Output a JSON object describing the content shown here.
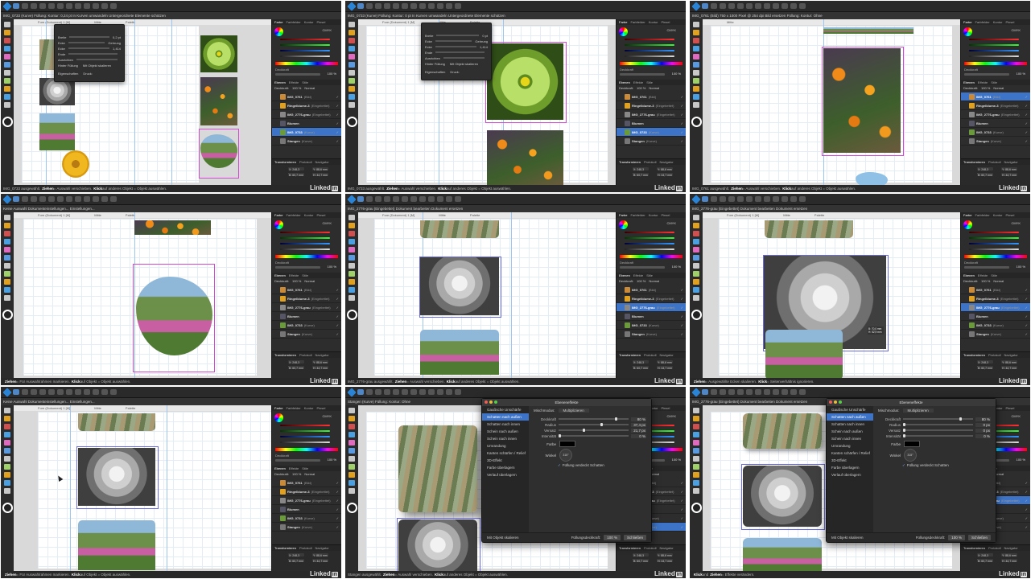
{
  "brand": {
    "watermark": "Linked",
    "watermark_badge": "in"
  },
  "colors": {
    "accent": "#3d74c7",
    "selection": "#d14bd1",
    "background": "#1e1e1e"
  },
  "panels": [
    {
      "id": 1,
      "ctx_text": "IMG_0733 (Kurve)   Füllung:   Kontur:   0,24 pt   In Kurven umwandeln   Untergeordnete Elemente schützen",
      "doc_tabs": [
        "Fore (Dokument) 1 [M]",
        "Mitte",
        "Palette"
      ],
      "right_tabs": [
        "Farbe",
        "Farbfelder",
        "Kontur",
        "Pinsel"
      ],
      "layers": [
        {
          "name": "IMG_0761",
          "sub": "(Bild)",
          "selected": false
        },
        {
          "name": "Ringelblume-3",
          "sub": "(Eingebettet)",
          "selected": false
        },
        {
          "name": "IMG_2776-grau",
          "sub": "(Eingebettet)",
          "selected": false
        },
        {
          "name": "Blumen",
          "sub": "",
          "selected": false
        },
        {
          "name": "IMG_0733",
          "sub": "(Kurve)",
          "selected": true
        },
        {
          "name": "Stangen",
          "sub": "(Kurve)",
          "selected": false
        }
      ],
      "status": {
        "prefix": "IMG_0733 ausgewählt.",
        "b1": "Ziehen",
        "t1": " = Auswahl verschieben.",
        "b2": "Klick",
        "t2": " auf anderes Objekt = Objekt auswählen."
      },
      "popup": {
        "rows": [
          "Breite",
          "Ecke",
          "Ecke",
          "Ende",
          "Ausrichten"
        ],
        "values": [
          "0,2 pt",
          "Gehrung",
          "1,414",
          "",
          ""
        ],
        "btn1": "Hinter Füllung",
        "btn2": "Mit Objekt skalieren",
        "label": "Eigenschaften",
        "druck": "Druck:"
      }
    },
    {
      "id": 2,
      "ctx_text": "IMG_0733 (Kurve)   Füllung:   Kontur:   0 pt   In Kurven umwandeln   Untergeordnete Elemente schützen",
      "doc_tabs": [
        "Fore (Dokument) 1 [M]",
        "Mitte",
        "Palette"
      ],
      "right_tabs": [
        "Farbe",
        "Farbfelder",
        "Kontur",
        "Pinsel"
      ],
      "layers": [
        {
          "name": "IMG_0761",
          "sub": "(Bild)",
          "selected": false
        },
        {
          "name": "Ringelblume-3",
          "sub": "(Eingebettet)",
          "selected": false
        },
        {
          "name": "IMG_2776-grau",
          "sub": "(Eingebettet)",
          "selected": false
        },
        {
          "name": "Blumen",
          "sub": "",
          "selected": false
        },
        {
          "name": "IMG_0733",
          "sub": "(Kurve)",
          "selected": true
        },
        {
          "name": "Stangen",
          "sub": "(Kurve)",
          "selected": false
        }
      ],
      "status": {
        "prefix": "IMG_0733 ausgewählt.",
        "b1": "Ziehen",
        "t1": " = Auswahl verschieben.",
        "b2": "Klick",
        "t2": " auf anderes Objekt = Objekt auswählen."
      },
      "popup": {
        "rows": [
          "Breite",
          "Ecke",
          "Ecke",
          "Ende",
          "Ausrichten"
        ],
        "values": [
          "0 pt",
          "Gehrung",
          "1,414",
          "",
          ""
        ],
        "btn1": "Hinter Füllung",
        "btn2": "Mit Objekt skalieren",
        "label": "Eigenschaften",
        "druck": "Druck:"
      }
    },
    {
      "id": 3,
      "ctx_text": "IMG_0761 (Bild)   750 x 1000 Pixel @ 254 dpi   Bild ersetzen   Füllung:   Kontur:   Ohne",
      "doc_tabs": [
        "Mitte"
      ],
      "right_tabs": [
        "Farbe",
        "Farbfelder",
        "Kontur",
        "Pinsel"
      ],
      "layers": [
        {
          "name": "IMG_0761",
          "sub": "(Bild)",
          "selected": true
        },
        {
          "name": "Ringelblume-3",
          "sub": "(Eingebettet)",
          "selected": false
        },
        {
          "name": "IMG_2776-grau",
          "sub": "(Eingebettet)",
          "selected": false
        },
        {
          "name": "Blumen",
          "sub": "",
          "selected": false
        },
        {
          "name": "IMG_0733",
          "sub": "(Kurve)",
          "selected": false
        },
        {
          "name": "Stangen",
          "sub": "(Kurve)",
          "selected": false
        }
      ],
      "status": {
        "prefix": "IMG_0761 ausgewählt.",
        "b1": "Ziehen",
        "t1": " = Auswahl verschieben.",
        "b2": "Klick",
        "t2": " auf anderes Objekt = Objekt auswählen."
      }
    },
    {
      "id": 4,
      "ctx_text": "Keine Auswahl   Dokumenteinstellungen...   Einstellungen...",
      "doc_tabs": [
        "Fore (Dokument) 1 [M]",
        "Mitte",
        "Palette"
      ],
      "right_tabs": [
        "Farbe",
        "Farbfelder",
        "Kontur",
        "Pinsel"
      ],
      "layers": [
        {
          "name": "IMG_0761",
          "sub": "(Bild)",
          "selected": false
        },
        {
          "name": "Ringelblume-3",
          "sub": "(Eingebettet)",
          "selected": false
        },
        {
          "name": "IMG_2776-grau",
          "sub": "(Eingebettet)",
          "selected": false
        },
        {
          "name": "Blumen",
          "sub": "",
          "selected": false
        },
        {
          "name": "IMG_0733",
          "sub": "(Kurve)",
          "selected": false
        },
        {
          "name": "Stangen",
          "sub": "(Kurve)",
          "selected": false
        }
      ],
      "status": {
        "prefix": "",
        "b1": "Ziehen",
        "t1": " = Für Auswahlrahmen markieren.",
        "b2": "Klick",
        "t2": " auf Objekt = Objekt auswählen."
      }
    },
    {
      "id": 5,
      "ctx_text": "IMG_2776-grau (Eingebettet)   Dokument bearbeiten   Dokument ersetzen",
      "doc_tabs": [
        "Fore (Dokument) 1 [M]",
        "Mitte",
        "Palette"
      ],
      "right_tabs": [
        "Farbe",
        "Farbfelder",
        "Kontur",
        "Pinsel"
      ],
      "layers": [
        {
          "name": "IMG_0761",
          "sub": "(Bild)",
          "selected": false
        },
        {
          "name": "Ringelblume-3",
          "sub": "(Eingebettet)",
          "selected": false
        },
        {
          "name": "IMG_2776-grau",
          "sub": "(Eingebettet)",
          "selected": true
        },
        {
          "name": "Blumen",
          "sub": "",
          "selected": false
        },
        {
          "name": "IMG_0733",
          "sub": "(Kurve)",
          "selected": false
        },
        {
          "name": "Stangen",
          "sub": "(Kurve)",
          "selected": false
        }
      ],
      "status": {
        "prefix": "IMG_2776-grau ausgewählt.",
        "b1": "Ziehen",
        "t1": " = Auswahl verschieben.",
        "b2": "Klick",
        "t2": " auf anderes Objekt = Objekt auswählen."
      }
    },
    {
      "id": 6,
      "ctx_text": "IMG_2776-grau (Eingebettet)   Dokument bearbeiten   Dokument ersetzen",
      "doc_tabs": [
        "Fore (Dokument) 1 [M]",
        "Mitte",
        "Palette"
      ],
      "right_tabs": [
        "Farbe",
        "Farbfelder",
        "Kontur",
        "Pinsel"
      ],
      "layers": [
        {
          "name": "IMG_0761",
          "sub": "(Bild)",
          "selected": false
        },
        {
          "name": "Ringelblume-3",
          "sub": "(Eingebettet)",
          "selected": false
        },
        {
          "name": "IMG_2776-grau",
          "sub": "(Eingebettet)",
          "selected": true
        },
        {
          "name": "Blumen",
          "sub": "",
          "selected": false
        },
        {
          "name": "IMG_0733",
          "sub": "(Kurve)",
          "selected": false
        },
        {
          "name": "Stangen",
          "sub": "(Kurve)",
          "selected": false
        }
      ],
      "size_badge": "B: 70,0 mm H: 52,9 mm",
      "status": {
        "prefix": "",
        "b1": "Ziehen",
        "t1": " = Ausgewählte Ecken skalieren.",
        "b2": "Klick",
        "t2": " = Seitenverhältnis ignorieren."
      }
    },
    {
      "id": 7,
      "ctx_text": "Keine Auswahl   Dokumenteinstellungen...   Einstellungen...",
      "doc_tabs": [
        "Fore (Dokument) 1 [M]",
        "Mitte",
        "Palette"
      ],
      "right_tabs": [
        "Farbe",
        "Farbfelder",
        "Kontur",
        "Pinsel"
      ],
      "layers": [
        {
          "name": "IMG_0761",
          "sub": "(Bild)",
          "selected": false
        },
        {
          "name": "Ringelblume-3",
          "sub": "(Eingebettet)",
          "selected": false
        },
        {
          "name": "IMG_2776-grau",
          "sub": "(Eingebettet)",
          "selected": false
        },
        {
          "name": "Blumen",
          "sub": "",
          "selected": false
        },
        {
          "name": "IMG_0733",
          "sub": "(Kurve)",
          "selected": false
        },
        {
          "name": "Stangen",
          "sub": "(Kurve)",
          "selected": false
        }
      ],
      "status": {
        "prefix": "",
        "b1": "Ziehen",
        "t1": " = Für Auswahlrahmen markieren.",
        "b2": "Klick",
        "t2": " auf Objekt = Objekt auswählen."
      }
    },
    {
      "id": 8,
      "ctx_text": "Stangen (Kurve)   Füllung:   Kontur:   Ohne",
      "doc_tabs": [],
      "right_tabs": [
        "Farbe",
        "Farbfelder",
        "Kontur",
        "Pinsel"
      ],
      "layers": [
        {
          "name": "IMG_0761",
          "sub": "(Bild)",
          "selected": false
        },
        {
          "name": "Ringelblume-3",
          "sub": "(Eingebettet)",
          "selected": false
        },
        {
          "name": "IMG_2776-grau",
          "sub": "(Eingebettet)",
          "selected": false
        },
        {
          "name": "Blumen",
          "sub": "",
          "selected": false
        },
        {
          "name": "IMG_0733",
          "sub": "(Kurve)",
          "selected": false
        },
        {
          "name": "Stangen",
          "sub": "(Kurve)",
          "selected": true
        }
      ],
      "status": {
        "prefix": "Stangen ausgewählt.",
        "b1": "Ziehen",
        "t1": " = Auswahl verschieben.",
        "b2": "Klick",
        "t2": " auf anderes Objekt = Objekt auswählen."
      },
      "dialog": {
        "title": "Ebeneneffekte",
        "effects": [
          "Gaußsche Unschärfe",
          "Schatten nach außen",
          "Schatten nach innen",
          "Schein nach außen",
          "Schein nach innen",
          "Umrandung",
          "Kanten schärfen / Relief",
          "3D-Effekt",
          "Farbe überlagern",
          "Verlauf überlagern"
        ],
        "selected_index": 1,
        "mode_label": "Mischmodus:",
        "mode_value": "Multiplizieren",
        "params": [
          {
            "label": "Deckkraft",
            "value": "80 %",
            "level": 0.8
          },
          {
            "label": "Radius",
            "value": "37,4 px",
            "level": 0.6
          },
          {
            "label": "Versatz",
            "value": "21,7 px",
            "level": 0.35
          },
          {
            "label": "Intensität",
            "value": "0 %",
            "level": 0.0
          }
        ],
        "color_label": "Farbe",
        "angle_label": "Winkel",
        "angle_value": "315°",
        "checkbox": "Füllung verdeckt Schatten",
        "scale_label": "Mit Objekt skalieren",
        "fill_label": "Füllungsdeckkraft:",
        "fill_value": "100 %",
        "close_label": "Schließen"
      }
    },
    {
      "id": 9,
      "ctx_text": "IMG_2776-grau (Eingebettet)   Dokument bearbeiten   Dokument ersetzen",
      "doc_tabs": [],
      "right_tabs": [
        "Farbe",
        "Farbfelder",
        "Kontur",
        "Pinsel"
      ],
      "layers": [
        {
          "name": "IMG_0761",
          "sub": "(Bild)",
          "selected": false
        },
        {
          "name": "Ringelblume-3",
          "sub": "(Eingebettet)",
          "selected": false
        },
        {
          "name": "IMG_2776-grau",
          "sub": "(Eingebettet)",
          "selected": true
        },
        {
          "name": "Blumen",
          "sub": "",
          "selected": false
        },
        {
          "name": "IMG_0733",
          "sub": "(Kurve)",
          "selected": false
        },
        {
          "name": "Stangen",
          "sub": "(Kurve)",
          "selected": false
        }
      ],
      "status": {
        "prefix": "",
        "b1": "Klick",
        "t1": " und ",
        "b2": "Ziehen",
        "t2": " = Effekte verändern."
      },
      "dialog": {
        "title": "Ebeneneffekte",
        "effects": [
          "Gaußsche Unschärfe",
          "Schatten nach außen",
          "Schatten nach innen",
          "Schein nach außen",
          "Schein nach innen",
          "Umrandung",
          "Kanten schärfen / Relief",
          "3D-Effekt",
          "Farbe überlagern",
          "Verlauf überlagern"
        ],
        "selected_index": 1,
        "mode_label": "Mischmodus:",
        "mode_value": "Multiplizieren",
        "params": [
          {
            "label": "Deckkraft",
            "value": "80 %",
            "level": 0.8
          },
          {
            "label": "Radius",
            "value": "0 px",
            "level": 0.0
          },
          {
            "label": "Versatz",
            "value": "0 px",
            "level": 0.0
          },
          {
            "label": "Intensität",
            "value": "0 %",
            "level": 0.0
          }
        ],
        "color_label": "Farbe",
        "angle_label": "Winkel",
        "angle_value": "315°",
        "checkbox": "Füllung verdeckt Schatten",
        "scale_label": "Mit Objekt skalieren",
        "fill_label": "Füllungsdeckkraft:",
        "fill_value": "100 %",
        "close_label": "Schließen"
      }
    }
  ],
  "common": {
    "color_mode": "CMYK",
    "opacity_label": "Deckkraft",
    "opacity_value": "100 %",
    "layers_tabs": [
      "Ebenen",
      "Effekte",
      "Stile"
    ],
    "blend_label": "Deckkraft:",
    "blend_value": "100 %",
    "blend_mode": "Normal",
    "transform_tabs": [
      "Transformieren",
      "Protokoll",
      "Navigator"
    ],
    "transform_values": [
      "X: 248,3 mm",
      "Y: 88,6 mm",
      "B: 60,7 mm",
      "H: 44,7 mm"
    ]
  }
}
